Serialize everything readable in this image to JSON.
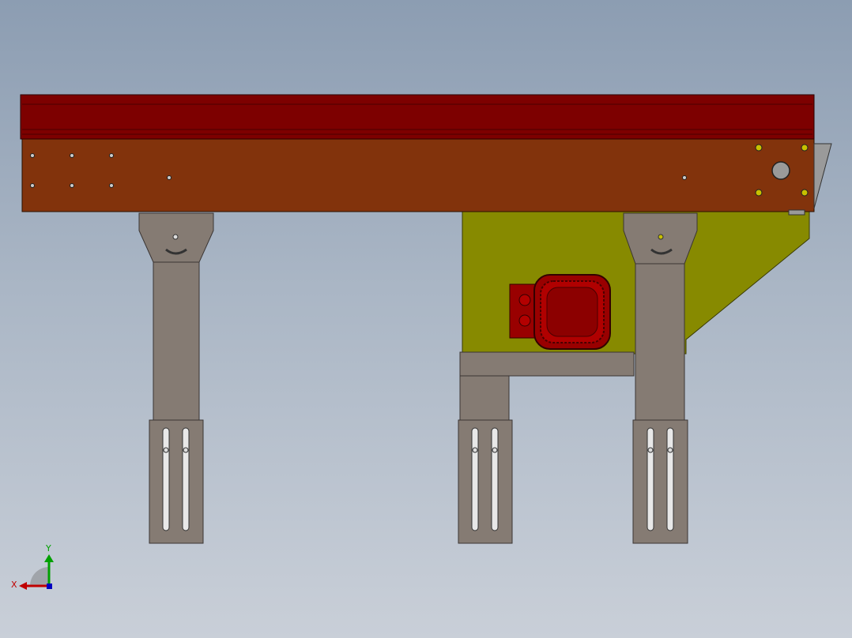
{
  "colors": {
    "belt_red": "#7d0000",
    "frame_orange": "#82330c",
    "leg_gray": "#857b73",
    "motor_plate_olive": "#878a00",
    "motor_red": "#990000",
    "axis_x": "#c00000",
    "axis_y": "#00a000",
    "axis_z": "#0000c0"
  },
  "triad": {
    "x_label": "X",
    "y_label": "Y"
  },
  "model": {
    "parts": [
      "conveyor-belt",
      "side-frame",
      "support-leg",
      "motor-mount-plate",
      "gear-motor",
      "adjustable-foot"
    ]
  }
}
